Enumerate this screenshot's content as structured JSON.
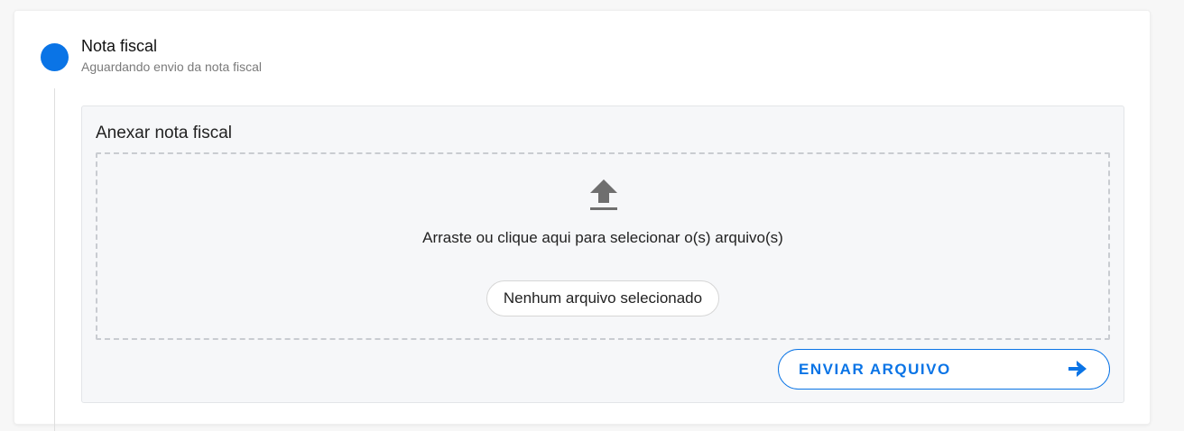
{
  "step": {
    "title": "Nota fiscal",
    "subtitle": "Aguardando envio da nota fiscal",
    "status_color": "#0a74e6"
  },
  "attach": {
    "title": "Anexar nota fiscal",
    "dropzone_text": "Arraste ou clique aqui para selecionar o(s) arquivo(s)",
    "dropzone_icon": "upload-icon",
    "file_status": "Nenhum arquivo selecionado"
  },
  "actions": {
    "send_label": "ENVIAR ARQUIVO",
    "send_icon": "arrow-right-icon",
    "accent_color": "#0a74e6"
  }
}
